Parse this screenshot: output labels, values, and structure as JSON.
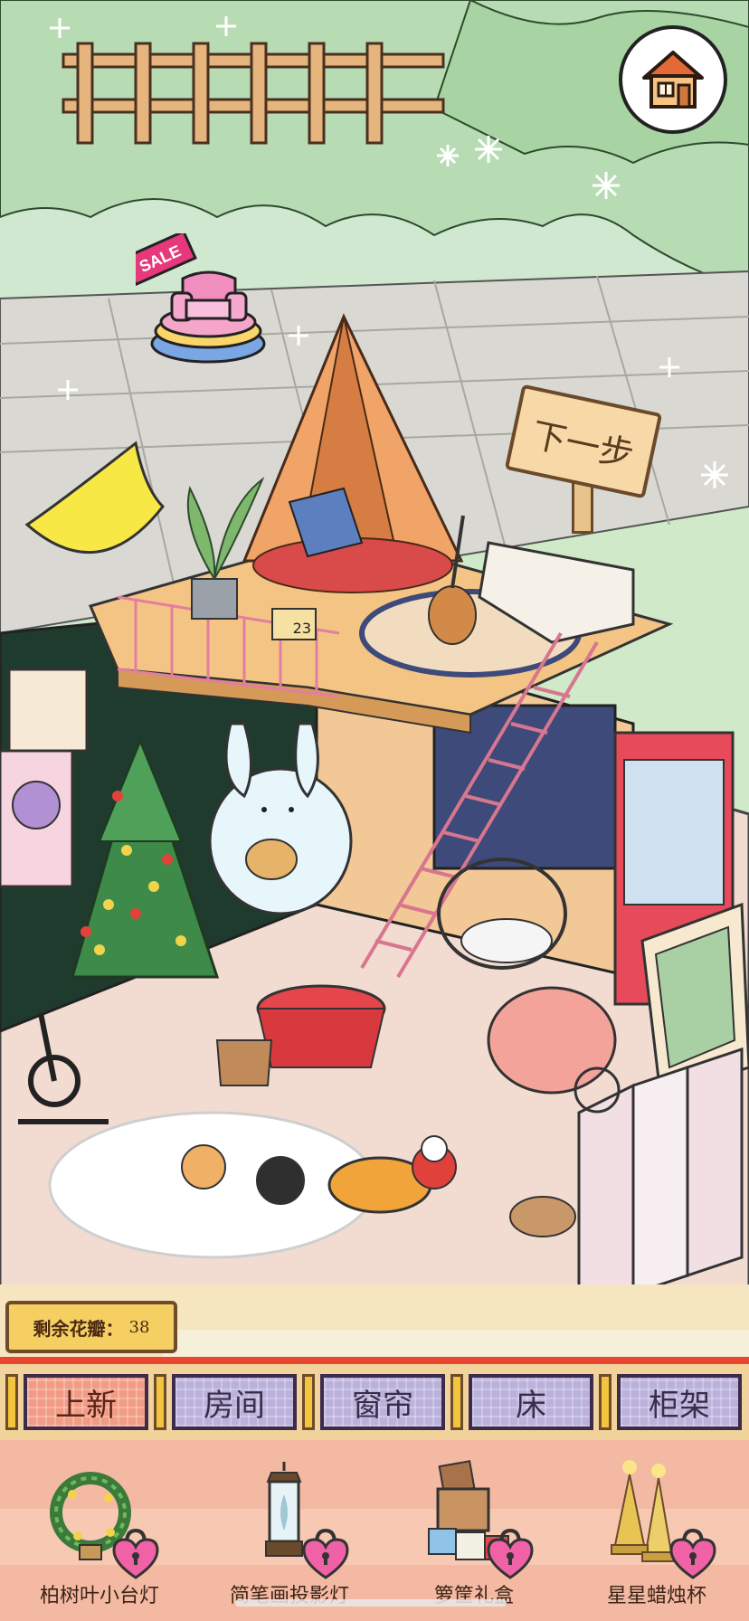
{
  "hud": {
    "home_button_icon": "house-icon",
    "sale_badge_text": "SALE",
    "next_step_label": "下一步",
    "petals_label": "剩余花瓣：",
    "petals_count": "38",
    "calendar_number": "23"
  },
  "tabs": [
    {
      "label": "上新",
      "active": true
    },
    {
      "label": "房间",
      "active": false
    },
    {
      "label": "窗帘",
      "active": false
    },
    {
      "label": "床",
      "active": false
    },
    {
      "label": "柜架",
      "active": false
    }
  ],
  "items": [
    {
      "name": "柏树叶小台灯",
      "icon": "wreath-lamp-icon",
      "locked": true
    },
    {
      "name": "简笔画投影灯",
      "icon": "lantern-icon",
      "locked": true
    },
    {
      "name": "箩筐礼盒",
      "icon": "gift-box-icon",
      "locked": true
    },
    {
      "name": "星星蜡烛杯",
      "icon": "candle-trees-icon",
      "locked": true
    }
  ],
  "colors": {
    "tab_border": "#3c2b4a",
    "tab_bg": "#bbb2dc",
    "tab_active_bg": "#f29c86",
    "tabbar_top": "#e9462f",
    "shelf_bg": "#f4b9a2",
    "lock_pink": "#f061a6",
    "petal_badge": "#f6cf62"
  }
}
